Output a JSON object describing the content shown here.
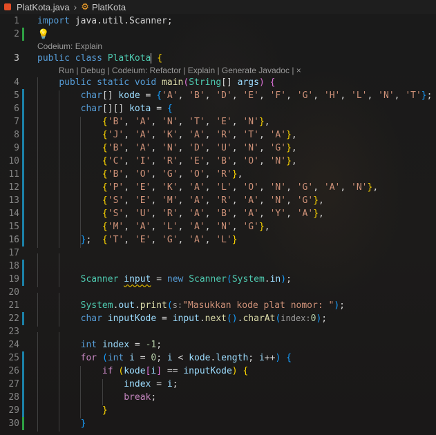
{
  "tab": {
    "file_name": "PlatKota.java",
    "class_crumb": "PlatKota"
  },
  "codelens_codeium": "Codeium: Explain",
  "codelens_main": "Run | Debug | Codeium: Refactor | Explain | Generate Javadoc | ×",
  "line_numbers": [
    "1",
    "2",
    "3",
    "4",
    "5",
    "6",
    "7",
    "8",
    "9",
    "10",
    "11",
    "12",
    "13",
    "14",
    "15",
    "16",
    "17",
    "18",
    "19",
    "20",
    "21",
    "22",
    "23",
    "24",
    "25",
    "26",
    "27",
    "28",
    "29",
    "30"
  ],
  "code": {
    "l1": [
      "import",
      " java.util.Scanner;"
    ],
    "l3": [
      "public",
      " ",
      "class",
      " PlatKota ",
      "{"
    ],
    "l4": [
      "public",
      " ",
      "static",
      " ",
      "void",
      " ",
      "main",
      "(",
      "String",
      "[] ",
      "args",
      ") ",
      "{"
    ],
    "l5": [
      "char",
      "[] ",
      "kode",
      " = ",
      "{",
      "'A'",
      ", ",
      "'B'",
      ", ",
      "'D'",
      ", ",
      "'E'",
      ", ",
      "'F'",
      ", ",
      "'G'",
      ", ",
      "'H'",
      ", ",
      "'L'",
      ", ",
      "'N'",
      ", ",
      "'T'",
      "}",
      ";"
    ],
    "l6": [
      "char",
      "[][] ",
      "kota",
      " = ",
      "{"
    ],
    "rows": [
      [
        "'B'",
        "'A'",
        "'N'",
        "'T'",
        "'E'",
        "'N'"
      ],
      [
        "'J'",
        "'A'",
        "'K'",
        "'A'",
        "'R'",
        "'T'",
        "'A'"
      ],
      [
        "'B'",
        "'A'",
        "'N'",
        "'D'",
        "'U'",
        "'N'",
        "'G'"
      ],
      [
        "'C'",
        "'I'",
        "'R'",
        "'E'",
        "'B'",
        "'O'",
        "'N'"
      ],
      [
        "'B'",
        "'O'",
        "'G'",
        "'O'",
        "'R'"
      ],
      [
        "'P'",
        "'E'",
        "'K'",
        "'A'",
        "'L'",
        "'O'",
        "'N'",
        "'G'",
        "'A'",
        "'N'"
      ],
      [
        "'S'",
        "'E'",
        "'M'",
        "'A'",
        "'R'",
        "'A'",
        "'N'",
        "'G'"
      ],
      [
        "'S'",
        "'U'",
        "'R'",
        "'A'",
        "'B'",
        "'A'",
        "'Y'",
        "'A'"
      ],
      [
        "'M'",
        "'A'",
        "'L'",
        "'A'",
        "'N'",
        "'G'"
      ],
      [
        "'T'",
        "'E'",
        "'G'",
        "'A'",
        "'L'"
      ]
    ],
    "l16": [
      "}",
      ";"
    ],
    "l18": [
      "Scanner",
      " ",
      "input",
      " = ",
      "new",
      " ",
      "Scanner",
      "(",
      "System",
      ".",
      "in",
      ");"
    ],
    "l21": [
      "System",
      ".",
      "out",
      ".",
      "print",
      "(",
      "s:",
      "\"Masukkan kode plat nomor: \"",
      ");"
    ],
    "l22": [
      "char",
      " ",
      "inputKode",
      " = ",
      "input",
      ".",
      "next",
      "().",
      "charAt",
      "(",
      "index:",
      "0",
      ");"
    ],
    "l24": [
      "int",
      " ",
      "index",
      " = ",
      "-1",
      ";"
    ],
    "l25": [
      "for",
      " (",
      "int",
      " ",
      "i",
      " = ",
      "0",
      "; ",
      "i",
      " < ",
      "kode",
      ".",
      "length",
      "; ",
      "i",
      "++) ",
      "{"
    ],
    "l26": [
      "if",
      " (",
      "kode",
      "[",
      "i",
      "] == ",
      "inputKode",
      ") ",
      "{"
    ],
    "l27": [
      "index",
      " = ",
      "i",
      ";"
    ],
    "l28": [
      "break",
      ";"
    ],
    "l29": [
      "}"
    ],
    "l30": [
      "}"
    ]
  }
}
